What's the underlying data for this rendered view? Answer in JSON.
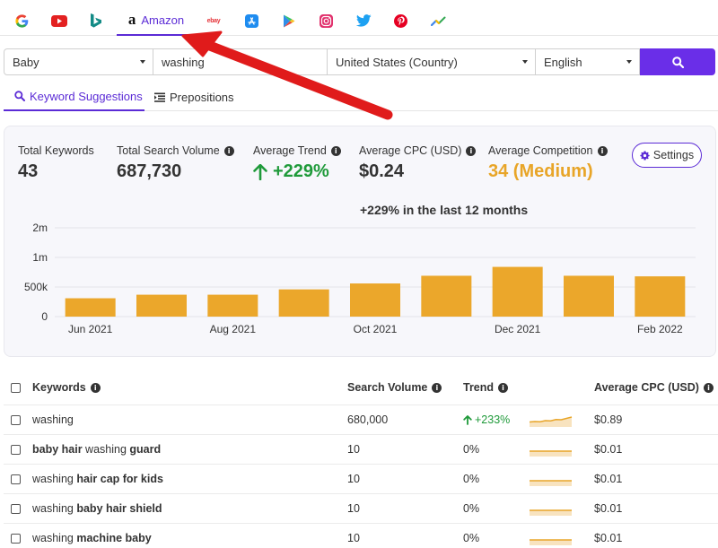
{
  "platforms": [
    {
      "id": "google",
      "icon": "google-icon"
    },
    {
      "id": "youtube",
      "icon": "youtube-icon"
    },
    {
      "id": "bing",
      "icon": "bing-icon"
    },
    {
      "id": "amazon",
      "icon": "amazon-icon",
      "label": "Amazon",
      "glyph": "a",
      "active": true
    },
    {
      "id": "ebay",
      "icon": "ebay-icon",
      "label": "ebay"
    },
    {
      "id": "appstore",
      "icon": "app-store-icon"
    },
    {
      "id": "playstore",
      "icon": "play-store-icon"
    },
    {
      "id": "instagram",
      "icon": "instagram-icon"
    },
    {
      "id": "twitter",
      "icon": "twitter-icon"
    },
    {
      "id": "pinterest",
      "icon": "pinterest-icon"
    },
    {
      "id": "trends",
      "icon": "trends-icon"
    }
  ],
  "search": {
    "category": "Baby",
    "query": "washing",
    "country": "United States (Country)",
    "language": "English"
  },
  "subtabs": {
    "suggestions": "Keyword Suggestions",
    "prepositions": "Prepositions"
  },
  "stats": {
    "total_keywords_label": "Total Keywords",
    "total_keywords": "43",
    "total_volume_label": "Total Search Volume",
    "total_volume": "687,730",
    "avg_trend_label": "Average Trend",
    "avg_trend": "+229%",
    "avg_cpc_label": "Average CPC (USD)",
    "avg_cpc": "$0.24",
    "avg_competition_label": "Average Competition",
    "avg_competition": "34 (Medium)",
    "settings_label": "Settings",
    "info_glyph": "i"
  },
  "chart_data": {
    "type": "bar",
    "title": "+229% in the last 12 months",
    "categories": [
      "2021-06",
      "2021-07",
      "2021-08",
      "2021-09",
      "2021-10",
      "2021-11",
      "2021-12",
      "2022-01",
      "2022-02"
    ],
    "x_tick_labels": [
      "Jun 2021",
      "Aug 2021",
      "Oct 2021",
      "Dec 2021",
      "Feb 2022"
    ],
    "values": [
      310000,
      370000,
      370000,
      460000,
      560000,
      690000,
      840000,
      690000,
      680000
    ],
    "y_ticks": [
      "0",
      "500k",
      "1m",
      "2m"
    ],
    "y_tick_values": [
      0,
      500000,
      1000000,
      1500000
    ],
    "ylim": [
      0,
      1500000
    ],
    "grid": true,
    "bar_color": "#eba72b"
  },
  "table": {
    "headers": {
      "keywords": "Keywords",
      "volume": "Search Volume",
      "trend": "Trend",
      "cpc": "Average CPC (USD)"
    },
    "rows": [
      {
        "parts": [
          [
            "washing",
            false
          ]
        ],
        "volume": "680,000",
        "trend": "+233%",
        "trend_up": true,
        "cpc": "$0.89",
        "spark": [
          0.45,
          0.5,
          0.48,
          0.6,
          0.58,
          0.72,
          0.7,
          0.85,
          1.0
        ]
      },
      {
        "parts": [
          [
            "baby hair ",
            true
          ],
          [
            "washing",
            false
          ],
          [
            " guard",
            true
          ]
        ],
        "volume": "10",
        "trend": "0%",
        "trend_up": false,
        "cpc": "$0.01",
        "spark": [
          0.5,
          0.5,
          0.5,
          0.5,
          0.5,
          0.5,
          0.5,
          0.5,
          0.5
        ]
      },
      {
        "parts": [
          [
            "washing ",
            false
          ],
          [
            "hair cap for kids",
            true
          ]
        ],
        "volume": "10",
        "trend": "0%",
        "trend_up": false,
        "cpc": "$0.01",
        "spark": [
          0.5,
          0.5,
          0.5,
          0.5,
          0.5,
          0.5,
          0.5,
          0.5,
          0.5
        ]
      },
      {
        "parts": [
          [
            "washing ",
            false
          ],
          [
            "baby hair shield",
            true
          ]
        ],
        "volume": "10",
        "trend": "0%",
        "trend_up": false,
        "cpc": "$0.01",
        "spark": [
          0.5,
          0.5,
          0.5,
          0.5,
          0.5,
          0.5,
          0.5,
          0.5,
          0.5
        ]
      },
      {
        "parts": [
          [
            "washing ",
            false
          ],
          [
            "machine baby",
            true
          ]
        ],
        "volume": "10",
        "trend": "0%",
        "trend_up": false,
        "cpc": "$0.01",
        "spark": [
          0.5,
          0.5,
          0.5,
          0.5,
          0.5,
          0.5,
          0.5,
          0.5,
          0.5
        ]
      }
    ]
  },
  "colors": {
    "accent": "#5b2bd6",
    "button": "#6a2ee8",
    "positive": "#1f9a3a",
    "competition": "#e8a528",
    "annotation_arrow": "#e01b1b"
  }
}
